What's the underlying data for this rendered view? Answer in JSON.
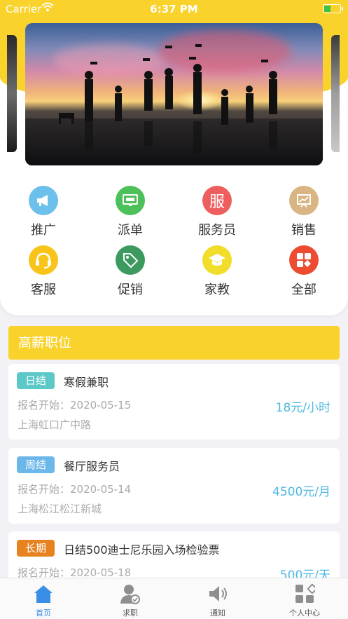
{
  "status_bar": {
    "carrier": "Carrier",
    "time": "6:37 PM"
  },
  "categories": [
    {
      "label": "推广",
      "icon": "megaphone-icon",
      "color": "#6cc0ec"
    },
    {
      "label": "派单",
      "icon": "monitor-icon",
      "color": "#4cc15a"
    },
    {
      "label": "服务员",
      "icon": "service-char-icon",
      "glyph": "服",
      "color": "#ef5e5e"
    },
    {
      "label": "销售",
      "icon": "sales-chart-icon",
      "color": "#d8b582"
    },
    {
      "label": "客服",
      "icon": "headset-icon",
      "color": "#f8c41a"
    },
    {
      "label": "促销",
      "icon": "tag-icon",
      "color": "#3c9a5f"
    },
    {
      "label": "家教",
      "icon": "graduation-cap-icon",
      "color": "#f2dd2a"
    },
    {
      "label": "全部",
      "icon": "grid-icon",
      "color": "#ee4c32"
    }
  ],
  "section": {
    "title": "高薪职位"
  },
  "jobs": [
    {
      "badge": "日结",
      "badge_color": "#5dc8c8",
      "title": "寒假兼职",
      "date": "报名开始：2020-05-15",
      "location": "上海虹口广中路",
      "pay": "18元/小时"
    },
    {
      "badge": "周结",
      "badge_color": "#6bb7e9",
      "title": "餐厅服务员",
      "date": "报名开始：2020-05-14",
      "location": "上海松江松江新城",
      "pay": "4500元/月"
    },
    {
      "badge": "长期",
      "badge_color": "#e6821f",
      "title": "日结500迪士尼乐园入场检验票",
      "date": "报名开始：2020-05-18",
      "location": "",
      "pay": "500元/天"
    }
  ],
  "tabbar": [
    {
      "label": "首页",
      "icon": "home-icon",
      "active": true
    },
    {
      "label": "求职",
      "icon": "user-check-icon",
      "active": false
    },
    {
      "label": "通知",
      "icon": "speaker-icon",
      "active": false
    },
    {
      "label": "个人中心",
      "icon": "profile-grid-icon",
      "active": false
    }
  ]
}
